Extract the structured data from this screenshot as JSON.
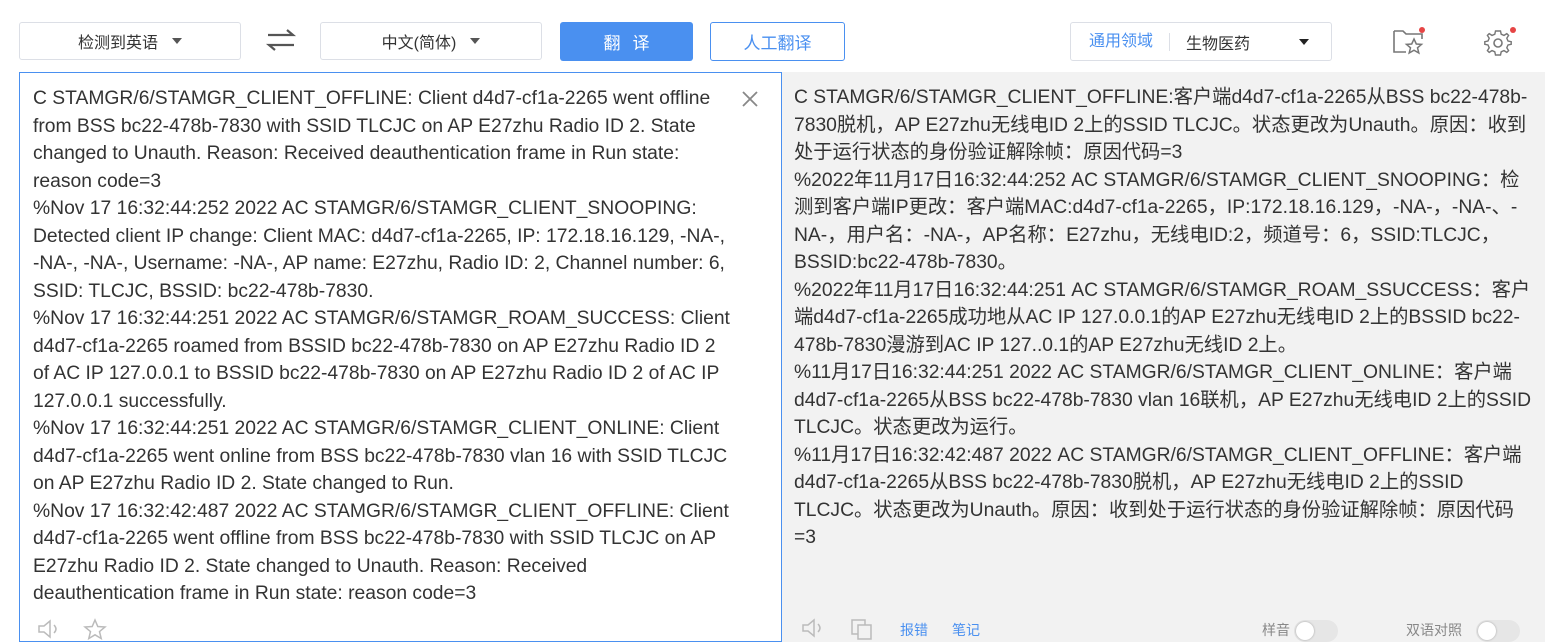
{
  "toolbar": {
    "source_language": "检测到英语",
    "target_language": "中文(简体)",
    "translate_button": "翻译",
    "human_translate_button": "人工翻译",
    "domain_label": "通用领域",
    "domain_value": "生物医药",
    "accent_color": "#4a90f0",
    "icons": [
      "swap-icon",
      "favorites-icon",
      "settings-icon"
    ]
  },
  "source": {
    "text": "C STAMGR/6/STAMGR_CLIENT_OFFLINE: Client d4d7-cf1a-2265 went offline from BSS bc22-478b-7830 with SSID TLCJC on AP E27zhu Radio ID 2. State changed to Unauth. Reason: Received deauthentication frame in Run state: reason code=3\n%Nov 17 16:32:44:252 2022 AC STAMGR/6/STAMGR_CLIENT_SNOOPING: Detected client IP change: Client MAC: d4d7-cf1a-2265, IP: 172.18.16.129, -NA-, -NA-, -NA-, Username: -NA-, AP name: E27zhu, Radio ID: 2, Channel number: 6, SSID: TLCJC, BSSID: bc22-478b-7830.\n%Nov 17 16:32:44:251 2022 AC STAMGR/6/STAMGR_ROAM_SUCCESS: Client d4d7-cf1a-2265 roamed from BSSID bc22-478b-7830 on AP E27zhu Radio ID 2 of AC IP 127.0.0.1 to BSSID bc22-478b-7830 on AP E27zhu Radio ID 2 of AC IP 127.0.0.1 successfully.\n%Nov 17 16:32:44:251 2022 AC STAMGR/6/STAMGR_CLIENT_ONLINE: Client d4d7-cf1a-2265 went online from BSS bc22-478b-7830 vlan 16 with SSID TLCJC on AP E27zhu Radio ID 2. State changed to Run.\n%Nov 17 16:32:42:487 2022 AC STAMGR/6/STAMGR_CLIENT_OFFLINE: Client d4d7-cf1a-2265 went offline from BSS bc22-478b-7830 with SSID TLCJC on AP E27zhu Radio ID 2. State changed to Unauth. Reason: Received deauthentication frame in Run state: reason code=3"
  },
  "target": {
    "text": "C STAMGR/6/STAMGR_CLIENT_OFFLINE:客户端d4d7-cf1a-2265从BSS bc22-478b-7830脱机，AP E27zhu无线电ID 2上的SSID TLCJC。状态更改为Unauth。原因：收到处于运行状态的身份验证解除帧：原因代码=3\n%2022年11月17日16:32:44:252 AC STAMGR/6/STAMGR_CLIENT_SNOOPING：检测到客户端IP更改：客户端MAC:d4d7-cf1a-2265，IP:172.18.16.129，-NA-，-NA-、-NA-，用户名：-NA-，AP名称：E27zhu，无线电ID:2，频道号：6，SSID:TLCJC，BSSID:bc22-478b-7830。\n%2022年11月17日16:32:44:251 AC STAMGR/6/STAMGR_ROAM_SSUCCESS：客户端d4d7-cf1a-2265成功地从AC IP 127.0.0.1的AP E27zhu无线电ID 2上的BSSID bc22-478b-7830漫游到AC IP 127..0.1的AP E27zhu无线ID 2上。\n%11月17日16:32:44:251 2022 AC STAMGR/6/STAMGR_CLIENT_ONLINE：客户端d4d7-cf1a-2265从BSS bc22-478b-7830 vlan 16联机，AP E27zhu无线电ID 2上的SSID TLCJC。状态更改为运行。\n%11月17日16:32:42:487 2022 AC STAMGR/6/STAMGR_CLIENT_OFFLINE：客户端d4d7-cf1a-2265从BSS bc22-478b-7830脱机，AP E27zhu无线电ID 2上的SSID TLCJC。状态更改为Unauth。原因：收到处于运行状态的身份验证解除帧：原因代码=3"
  },
  "bottom": {
    "source_icons": [
      "speaker-icon",
      "star-icon"
    ],
    "target_icons": [
      "speaker-icon",
      "copy-icon"
    ],
    "target_links": [
      "报错",
      "笔记"
    ],
    "toggle_labels": [
      "样音",
      "双语对照"
    ]
  }
}
